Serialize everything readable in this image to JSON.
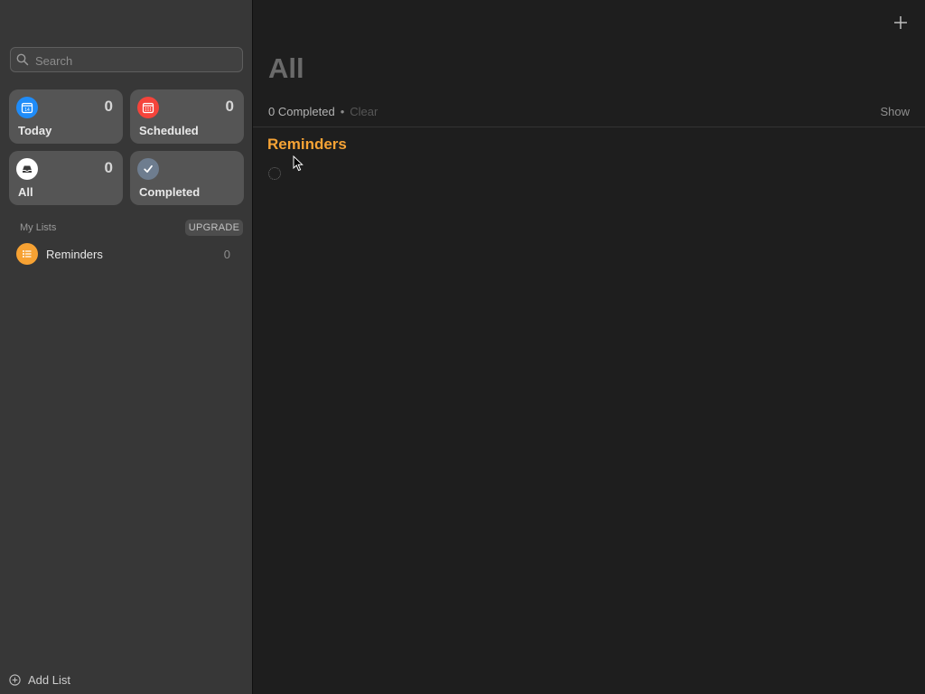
{
  "sidebar": {
    "search": {
      "placeholder": "Search",
      "value": ""
    },
    "smart_lists": [
      {
        "label": "Today",
        "count": "0",
        "icon": "calendar-today-icon",
        "color": "#1f8cf9"
      },
      {
        "label": "Scheduled",
        "count": "0",
        "icon": "calendar-scheduled-icon",
        "color": "#f5443b"
      },
      {
        "label": "All",
        "count": "0",
        "icon": "tray-icon",
        "color": "#ffffff"
      },
      {
        "label": "Completed",
        "count": "",
        "icon": "checkmark-icon",
        "color": "#6e7d8f"
      }
    ],
    "my_lists_header": "My Lists",
    "upgrade_label": "UPGRADE",
    "lists": [
      {
        "name": "Reminders",
        "count": "0",
        "color": "#f7a233",
        "icon": "list-bullet-icon"
      }
    ],
    "add_list_label": "Add List"
  },
  "main": {
    "title": "All",
    "completed_text": "0 Completed",
    "separator": "•",
    "clear_label": "Clear",
    "show_label": "Show",
    "groups": [
      {
        "title": "Reminders",
        "color": "#f6a335"
      }
    ]
  }
}
